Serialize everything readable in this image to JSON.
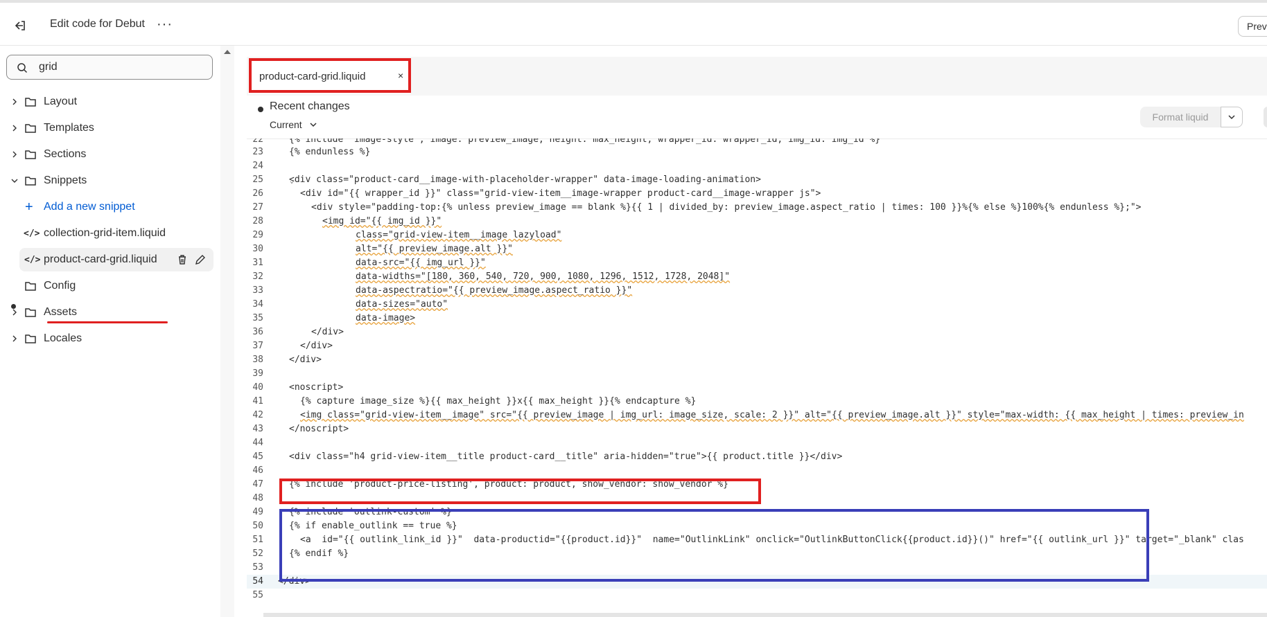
{
  "topbar": {
    "title": "Edit code for Debut",
    "more": "···",
    "preview_label": "Prev"
  },
  "sidebar": {
    "search_value": "grid",
    "items": [
      {
        "label": "Layout"
      },
      {
        "label": "Templates"
      },
      {
        "label": "Sections"
      },
      {
        "label": "Snippets"
      },
      {
        "label": "Add a new snippet"
      },
      {
        "label": "collection-grid-item.liquid"
      },
      {
        "label": "product-card-grid.liquid"
      },
      {
        "label": "Config"
      },
      {
        "label": "Assets"
      },
      {
        "label": "Locales"
      }
    ]
  },
  "editor": {
    "tab_label": "product-card-grid.liquid",
    "tab_close": "×",
    "changes_label": "Recent changes",
    "current_label": "Current",
    "format_label": "Format liquid"
  },
  "code_lines": {
    "l22": "{% include 'image-style', image: preview_image, height: max_height, wrapper_id: wrapper_id, img_id: img_id %}",
    "l23": "{% endunless %}",
    "l25": "<div class=\"product-card__image-with-placeholder-wrapper\" data-image-loading-animation>",
    "l26": "<div id=\"{{ wrapper_id }}\" class=\"grid-view-item__image-wrapper product-card__image-wrapper js\">",
    "l27": "<div style=\"padding-top:{% unless preview_image == blank %}{{ 1 | divided_by: preview_image.aspect_ratio | times: 100 }}%{% else %}100%{% endunless %};\">",
    "l28": "<img id=\"{{ img_id }}\"",
    "l29": "class=\"grid-view-item__image lazyload\"",
    "l30": "alt=\"{{ preview_image.alt }}\"",
    "l31": "data-src=\"{{ img_url }}\"",
    "l32": "data-widths=\"[180, 360, 540, 720, 900, 1080, 1296, 1512, 1728, 2048]\"",
    "l33": "data-aspectratio=\"{{ preview_image.aspect_ratio }}\"",
    "l34": "data-sizes=\"auto\"",
    "l35": "data-image>",
    "l36": "</div>",
    "l37": "</div>",
    "l38": "</div>",
    "l40": "<noscript>",
    "l41": "{% capture image_size %}{{ max_height }}x{{ max_height }}{% endcapture %}",
    "l42": "<img class=\"grid-view-item__image\" src=\"{{ preview_image | img_url: image_size, scale: 2 }}\" alt=\"{{ preview_image.alt }}\" style=\"max-width: {{ max_height | times: preview_in",
    "l43": "</noscript>",
    "l45": "<div class=\"h4 grid-view-item__title product-card__title\" aria-hidden=\"true\">{{ product.title }}</div>",
    "l47": "{% include 'product-price-listing', product: product, show_vendor: show_vendor %}",
    "l49": "{% include 'outlink-custom' %}",
    "l50": "{% if enable_outlink == true %}",
    "l51": "<a  id=\"{{ outlink_link_id }}\"  data-productid=\"{{product.id}}\"  name=\"OutlinkLink\" onclick=\"OutlinkButtonClick{{product.id}}()\" href=\"{{ outlink_url }}\" target=\"_blank\" clas",
    "l52": "{% endif %}",
    "l54": "</div>"
  }
}
